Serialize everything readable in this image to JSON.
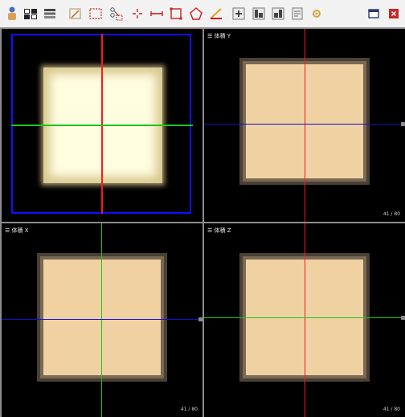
{
  "toolbar": {
    "tools": [
      {
        "name": "user-tool-icon"
      },
      {
        "name": "layout-2x2-icon"
      },
      {
        "name": "stack-icon"
      },
      {
        "name": "pencil-region-icon"
      },
      {
        "name": "rect-select-icon"
      },
      {
        "name": "cut-icon"
      },
      {
        "name": "point-icon"
      },
      {
        "name": "line-measure-icon"
      },
      {
        "name": "rect-tool-icon"
      },
      {
        "name": "polygon-tool-icon"
      },
      {
        "name": "angle-tool-icon"
      },
      {
        "name": "zoom-in-icon"
      },
      {
        "name": "align-left-icon"
      },
      {
        "name": "align-right-icon"
      },
      {
        "name": "note-icon"
      },
      {
        "name": "settings-icon"
      },
      {
        "name": "restore-window-icon"
      },
      {
        "name": "close-icon"
      }
    ]
  },
  "panes": {
    "tl": {
      "label": "",
      "slice": ""
    },
    "tr": {
      "label": "☰ 体積 Y",
      "slice": "41 / 80"
    },
    "bl": {
      "label": "☰ 体積 X",
      "slice": "41 / 80"
    },
    "br": {
      "label": "☰ 体積 Z",
      "slice": "41 / 80"
    }
  },
  "colors": {
    "crosshair_red": "#ff1a1a",
    "crosshair_green": "#18c818",
    "crosshair_blue": "#1010d8",
    "frame_blue": "#1010ff",
    "volume_fill": "#f0d2a2",
    "volume_bright": "#fffde0"
  }
}
